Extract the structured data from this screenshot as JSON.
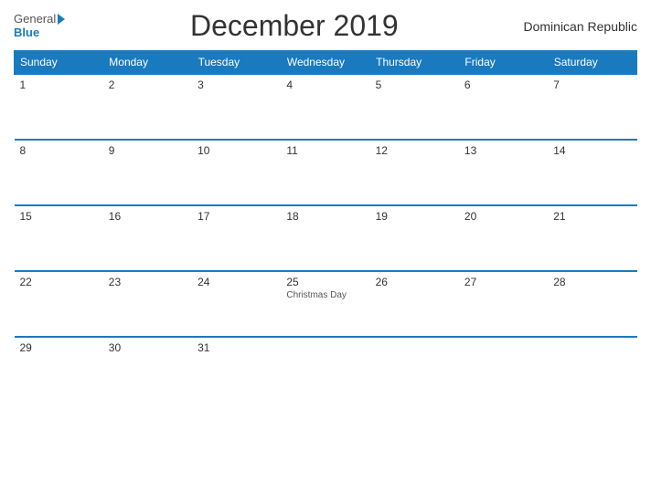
{
  "header": {
    "title": "December 2019",
    "country": "Dominican Republic",
    "logo_general": "General",
    "logo_blue": "Blue"
  },
  "weekdays": [
    "Sunday",
    "Monday",
    "Tuesday",
    "Wednesday",
    "Thursday",
    "Friday",
    "Saturday"
  ],
  "weeks": [
    [
      {
        "day": "1",
        "holiday": ""
      },
      {
        "day": "2",
        "holiday": ""
      },
      {
        "day": "3",
        "holiday": ""
      },
      {
        "day": "4",
        "holiday": ""
      },
      {
        "day": "5",
        "holiday": ""
      },
      {
        "day": "6",
        "holiday": ""
      },
      {
        "day": "7",
        "holiday": ""
      }
    ],
    [
      {
        "day": "8",
        "holiday": ""
      },
      {
        "day": "9",
        "holiday": ""
      },
      {
        "day": "10",
        "holiday": ""
      },
      {
        "day": "11",
        "holiday": ""
      },
      {
        "day": "12",
        "holiday": ""
      },
      {
        "day": "13",
        "holiday": ""
      },
      {
        "day": "14",
        "holiday": ""
      }
    ],
    [
      {
        "day": "15",
        "holiday": ""
      },
      {
        "day": "16",
        "holiday": ""
      },
      {
        "day": "17",
        "holiday": ""
      },
      {
        "day": "18",
        "holiday": ""
      },
      {
        "day": "19",
        "holiday": ""
      },
      {
        "day": "20",
        "holiday": ""
      },
      {
        "day": "21",
        "holiday": ""
      }
    ],
    [
      {
        "day": "22",
        "holiday": ""
      },
      {
        "day": "23",
        "holiday": ""
      },
      {
        "day": "24",
        "holiday": ""
      },
      {
        "day": "25",
        "holiday": "Christmas Day"
      },
      {
        "day": "26",
        "holiday": ""
      },
      {
        "day": "27",
        "holiday": ""
      },
      {
        "day": "28",
        "holiday": ""
      }
    ],
    [
      {
        "day": "29",
        "holiday": ""
      },
      {
        "day": "30",
        "holiday": ""
      },
      {
        "day": "31",
        "holiday": ""
      },
      {
        "day": "",
        "holiday": ""
      },
      {
        "day": "",
        "holiday": ""
      },
      {
        "day": "",
        "holiday": ""
      },
      {
        "day": "",
        "holiday": ""
      }
    ]
  ]
}
